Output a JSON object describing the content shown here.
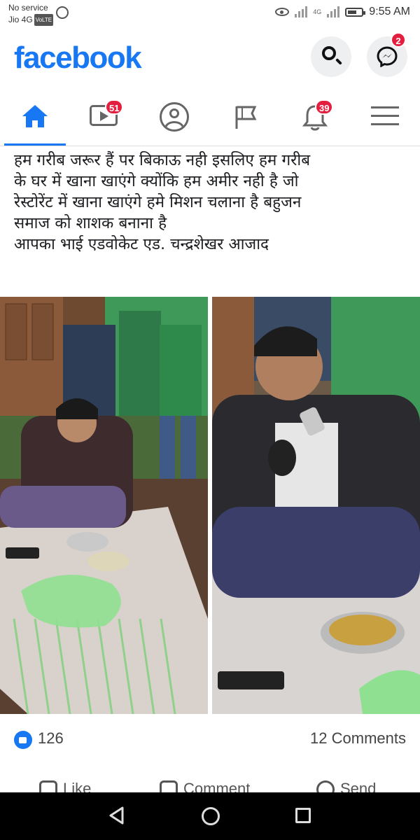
{
  "status_bar": {
    "carrier_line1": "No service",
    "carrier_line2": "Jio 4G",
    "volte": "VoLTE",
    "network_label": "4G",
    "time": "9:55 AM",
    "icons": [
      "whatsapp-icon",
      "eye-icon",
      "signal-icon",
      "battery-icon"
    ]
  },
  "header": {
    "logo": "facebook",
    "brand_color": "#1877f2",
    "messenger_badge": "2"
  },
  "nav": {
    "items": [
      {
        "name": "home",
        "icon": "home-icon",
        "active": true
      },
      {
        "name": "watch",
        "icon": "video-icon",
        "badge": "51"
      },
      {
        "name": "profile",
        "icon": "profile-icon"
      },
      {
        "name": "pages",
        "icon": "flag-icon"
      },
      {
        "name": "notifications",
        "icon": "bell-icon",
        "badge": "39"
      },
      {
        "name": "menu",
        "icon": "menu-icon"
      }
    ]
  },
  "post": {
    "text_lines": [
      "हम गरीब जरूर हैं पर बिकाऊ नही इसलिए हम गरीब",
      "के घर में खाना खाएंगे क्योंकि हम अमीर नही है जो",
      "रेस्टोरेंट में खाना खाएंगे हमे मिशन चलाना है बहुजन",
      "समाज को शाशक बनाना है",
      "आपका भाई एडवोकेट एड. चन्द्रशेखर आजाद"
    ],
    "like_count": "126",
    "comments": "12 Comments",
    "actions": {
      "like": "Like",
      "comment": "Comment",
      "send": "Send"
    }
  },
  "system_nav": {
    "icons": [
      "back-icon",
      "home-circle-icon",
      "recents-icon"
    ]
  }
}
